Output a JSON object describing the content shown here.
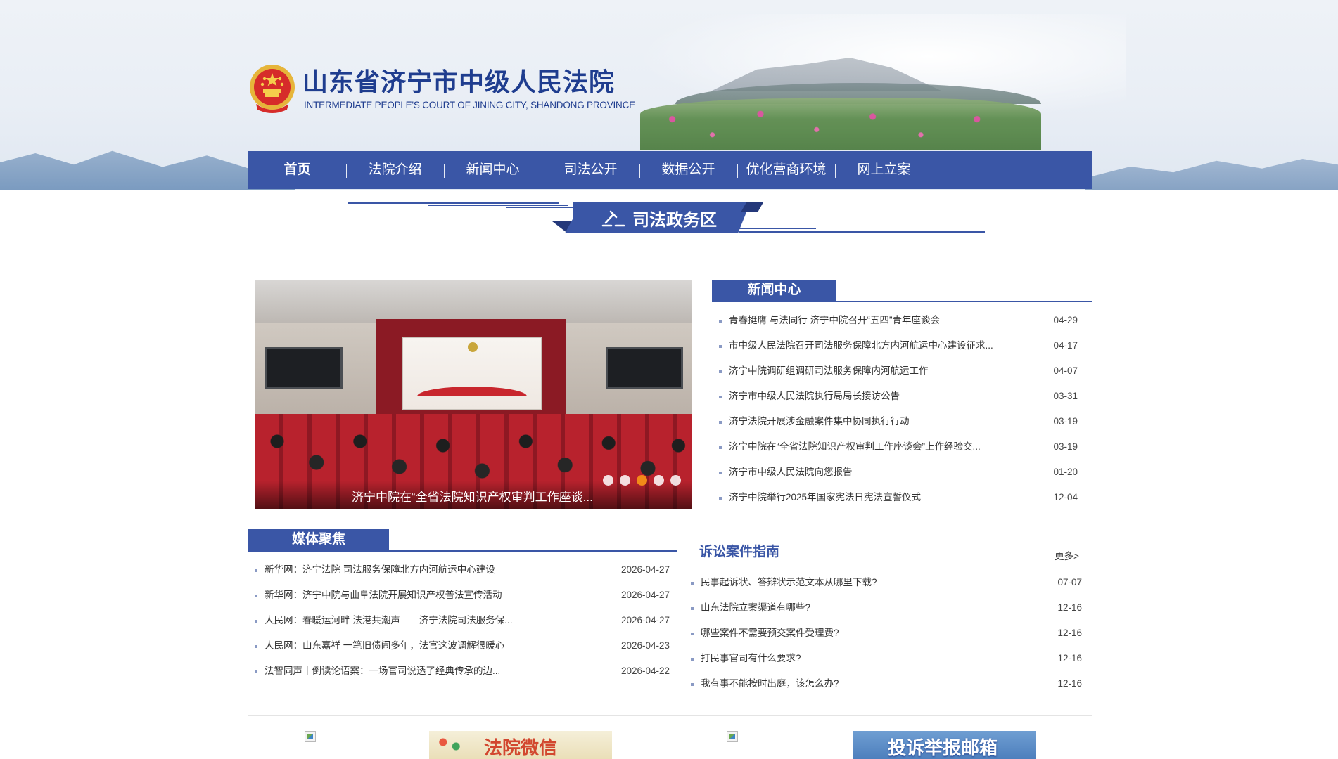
{
  "header": {
    "title": "山东省济宁市中级人民法院",
    "subtitle": "INTERMEDIATE PEOPLE'S COURT OF JINING CITY, SHANDONG PROVINCE",
    "logo_icon": "national-emblem-icon"
  },
  "nav": {
    "items": [
      {
        "label": "首页"
      },
      {
        "label": "法院介绍"
      },
      {
        "label": "新闻中心"
      },
      {
        "label": "司法公开"
      },
      {
        "label": "数据公开"
      },
      {
        "label": "优化营商环境"
      },
      {
        "label": "网上立案"
      }
    ]
  },
  "zone": {
    "label": "司法政务区",
    "icon": "gavel-icon"
  },
  "carousel": {
    "caption": "济宁中院在“全省法院知识产权审判工作座谈...",
    "dot_count": 5,
    "active_dot": 3,
    "active_color": "#f28a18"
  },
  "news_center": {
    "tab_label": "新闻中心",
    "items": [
      {
        "title": "青春挺膺 与法同行 济宁中院召开“五四”青年座谈会",
        "date": "04-29"
      },
      {
        "title": "市中级人民法院召开司法服务保障北方内河航运中心建设征求...",
        "date": "04-17"
      },
      {
        "title": "济宁中院调研组调研司法服务保障内河航运工作",
        "date": "04-07"
      },
      {
        "title": "济宁市中级人民法院执行局局长接访公告",
        "date": "03-31"
      },
      {
        "title": "济宁法院开展涉金融案件集中协同执行行动",
        "date": "03-19"
      },
      {
        "title": "济宁中院在“全省法院知识产权审判工作座谈会”上作经验交...",
        "date": "03-19"
      },
      {
        "title": "济宁市中级人民法院向您报告",
        "date": "01-20"
      },
      {
        "title": "济宁中院举行2025年国家宪法日宪法宣誓仪式",
        "date": "12-04"
      }
    ]
  },
  "media": {
    "tab_label": "媒体聚焦",
    "items": [
      {
        "title": "新华网：济宁法院 司法服务保障北方内河航运中心建设",
        "date": "2026-04-27"
      },
      {
        "title": "新华网：济宁中院与曲阜法院开展知识产权普法宣传活动",
        "date": "2026-04-27"
      },
      {
        "title": "人民网：春暖运河畔 法港共潮声——济宁法院司法服务保...",
        "date": "2026-04-27"
      },
      {
        "title": "人民网：山东嘉祥 一笔旧债闹多年，法官这波调解很暖心",
        "date": "2026-04-23"
      },
      {
        "title": "法智同声丨倒读论语案：一场官司说透了经典传承的边...",
        "date": "2026-04-22"
      }
    ]
  },
  "guide": {
    "title": "诉讼案件指南",
    "more": "更多>",
    "items": [
      {
        "title": "民事起诉状、答辩状示范文本从哪里下载?",
        "date": "07-07"
      },
      {
        "title": "山东法院立案渠道有哪些?",
        "date": "12-16"
      },
      {
        "title": "哪些案件不需要预交案件受理费?",
        "date": "12-16"
      },
      {
        "title": "打民事官司有什么要求?",
        "date": "12-16"
      },
      {
        "title": "我有事不能按时出庭，该怎么办?",
        "date": "12-16"
      }
    ]
  },
  "promos": {
    "wechat": "法院微信",
    "mail": "投诉举报邮箱"
  },
  "colors": {
    "brand": "#3a56a6",
    "title": "#1f3d8f"
  }
}
